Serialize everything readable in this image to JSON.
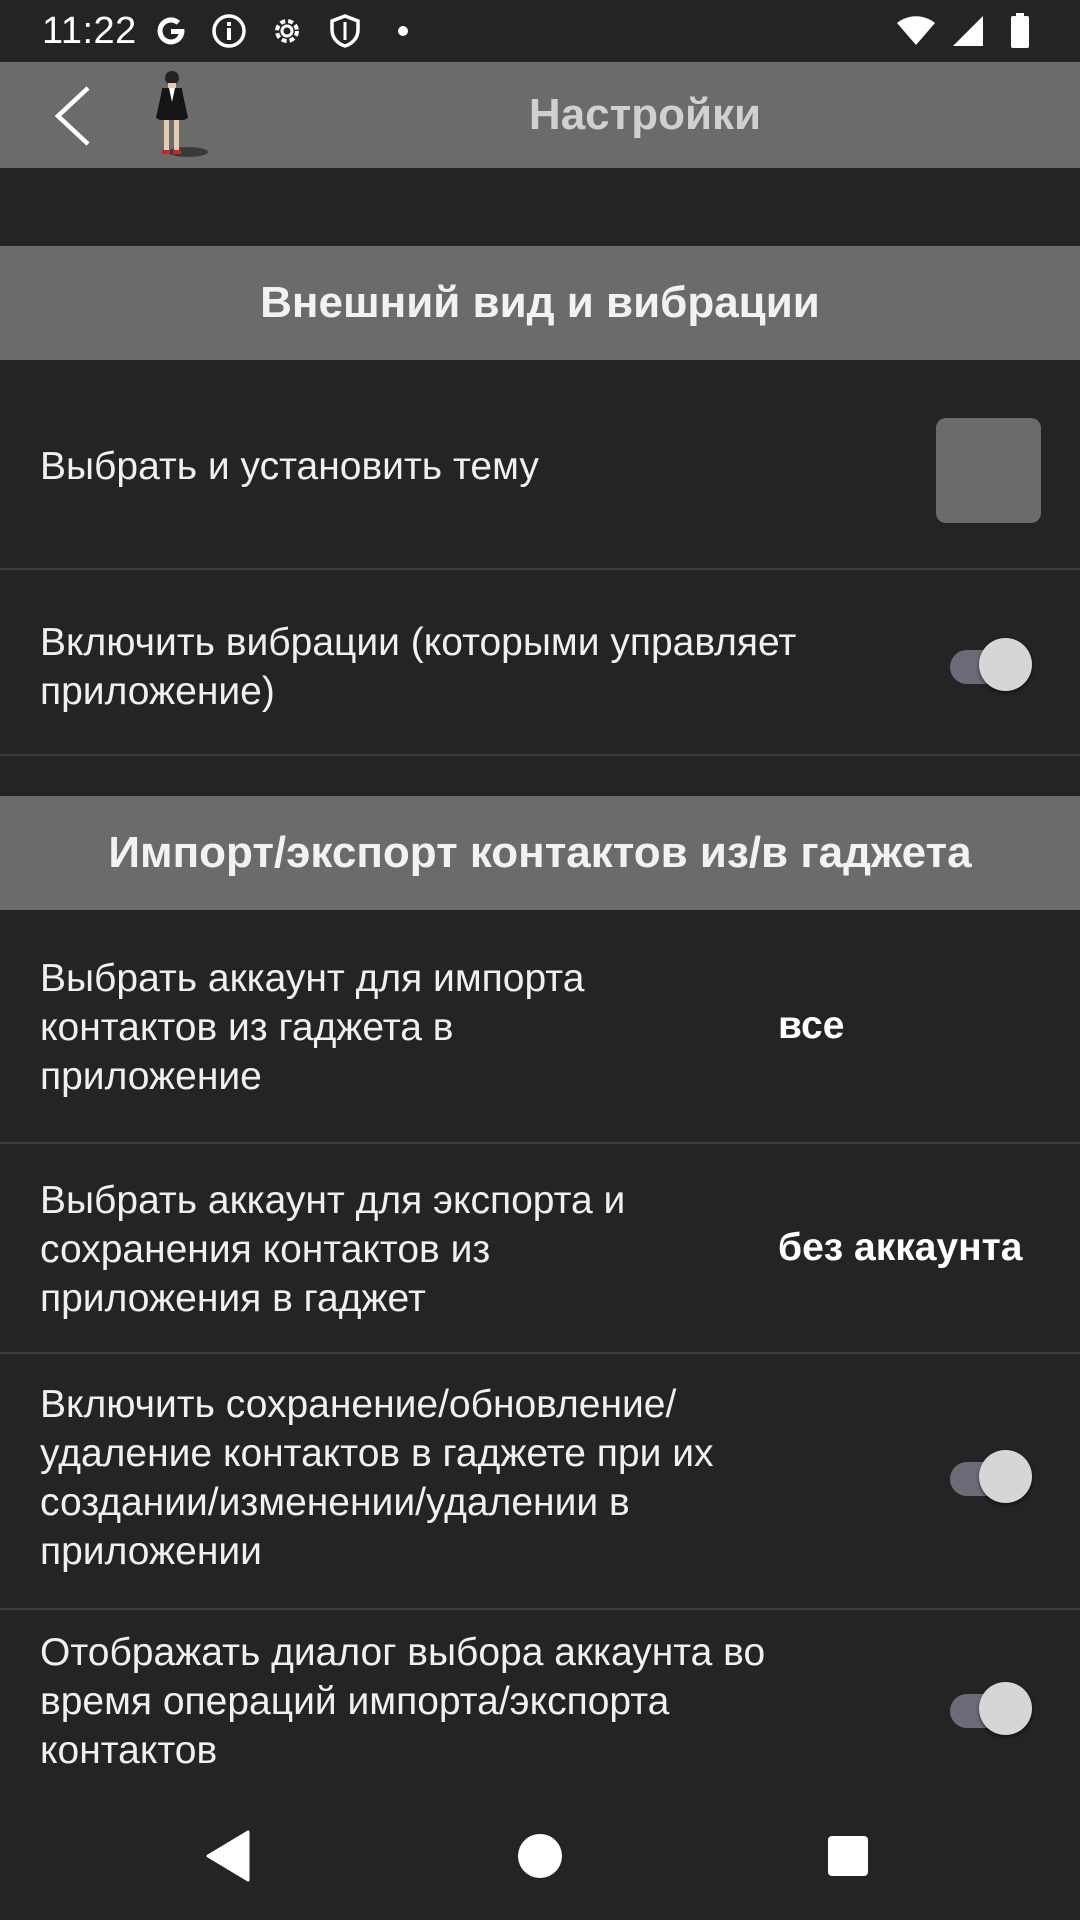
{
  "status_bar": {
    "time": "11:22",
    "icons_left": [
      "google-icon",
      "info-icon",
      "settings-icon",
      "shield-icon",
      "dot-icon"
    ],
    "icons_right": [
      "wifi-icon",
      "signal-icon",
      "battery-icon"
    ]
  },
  "app_bar": {
    "title": "Настройки",
    "back_icon": "back-arrow-icon",
    "logo": "app-logo-figure"
  },
  "sections": [
    {
      "header": "Внешний вид и вибрации",
      "items": [
        {
          "label": "Выбрать и установить тему",
          "control": "theme-swatch",
          "swatch_color": "#6b6b6b"
        },
        {
          "label": "Включить вибрации (которыми управляет приложение)",
          "control": "toggle",
          "checked": true
        }
      ]
    },
    {
      "header": "Импорт/экспорт контактов из/в гаджета",
      "items": [
        {
          "label": "Выбрать аккаунт для импорта контактов из гаджета в приложение",
          "control": "value",
          "value": "все"
        },
        {
          "label": "Выбрать аккаунт для экспорта и сохранения контактов из приложения в гаджет",
          "control": "value",
          "value": "без аккаунта"
        },
        {
          "label": "Включить сохранение/обновление/удаление контактов в гаджете при их создании/изменении/удалении в приложении",
          "control": "toggle",
          "checked": true
        },
        {
          "label": "Отображать диалог выбора аккаунта во время операций импорта/экспорта контактов",
          "control": "toggle",
          "checked": true
        }
      ]
    }
  ],
  "nav_bar": {
    "buttons": [
      "back-triangle-icon",
      "home-circle-icon",
      "recents-square-icon"
    ]
  },
  "colors": {
    "background": "#242424",
    "header": "#6b6b6b",
    "toggle_track": "#6f6a78",
    "toggle_thumb": "#d6d6d6"
  }
}
